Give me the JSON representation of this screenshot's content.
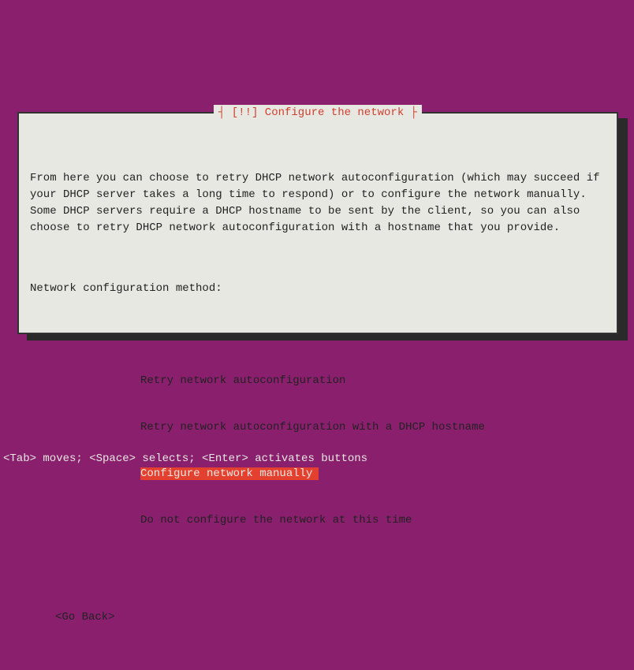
{
  "dialog": {
    "title": "┤ [!!] Configure the network ├",
    "body": "From here you can choose to retry DHCP network autoconfiguration (which may succeed if your DHCP server takes a long time to respond) or to configure the network manually. Some DHCP servers require a DHCP hostname to be sent by the client, so you can also choose to retry DHCP network autoconfiguration with a hostname that you provide.",
    "prompt": "Network configuration method:",
    "menu": {
      "items": [
        {
          "label": "Retry network autoconfiguration",
          "selected": false
        },
        {
          "label": "Retry network autoconfiguration with a DHCP hostname",
          "selected": false
        },
        {
          "label": "Configure network manually",
          "selected": true
        },
        {
          "label": "Do not configure the network at this time",
          "selected": false
        }
      ]
    },
    "go_back": "<Go Back>"
  },
  "status_bar": "<Tab> moves; <Space> selects; <Enter> activates buttons"
}
